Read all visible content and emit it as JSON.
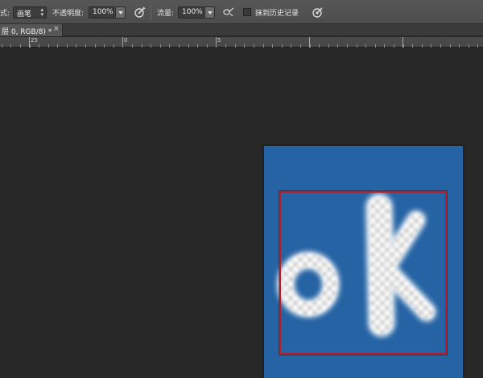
{
  "options_bar": {
    "mode_label_partial": "式:",
    "mode_value": "画笔",
    "opacity_label": "不透明度:",
    "opacity_value": "100%",
    "flow_label": "流量:",
    "flow_value": "100%",
    "history_label": "抹到历史记录",
    "icons": [
      "pressure-opacity-icon",
      "airbrush-icon",
      "pressure-size-icon"
    ]
  },
  "document_tab": {
    "title": "层 0, RGB/8) *",
    "close": "×"
  },
  "ruler": {
    "numbers": [
      "25",
      "0",
      "5"
    ]
  },
  "canvas": {
    "background_color": "#282828",
    "document_color": "#2563a4",
    "selection_color": "#b21f2a",
    "text": "oK"
  }
}
